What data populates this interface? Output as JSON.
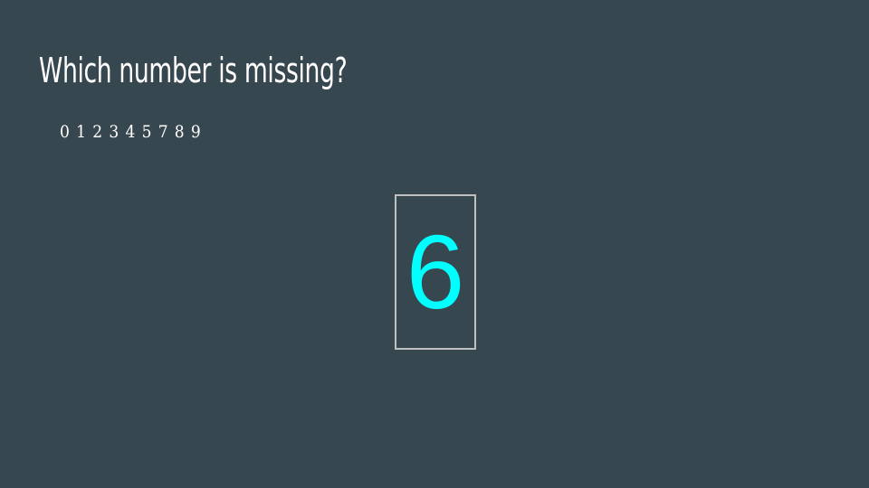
{
  "slide": {
    "title": "Which number is missing?",
    "sequence": "0 1 2 3 4 5 7 8 9",
    "answer": "6"
  },
  "colors": {
    "background": "#37474f",
    "text": "#ffffff",
    "answer": "#00ffff",
    "box_border": "#c0c0c0"
  }
}
